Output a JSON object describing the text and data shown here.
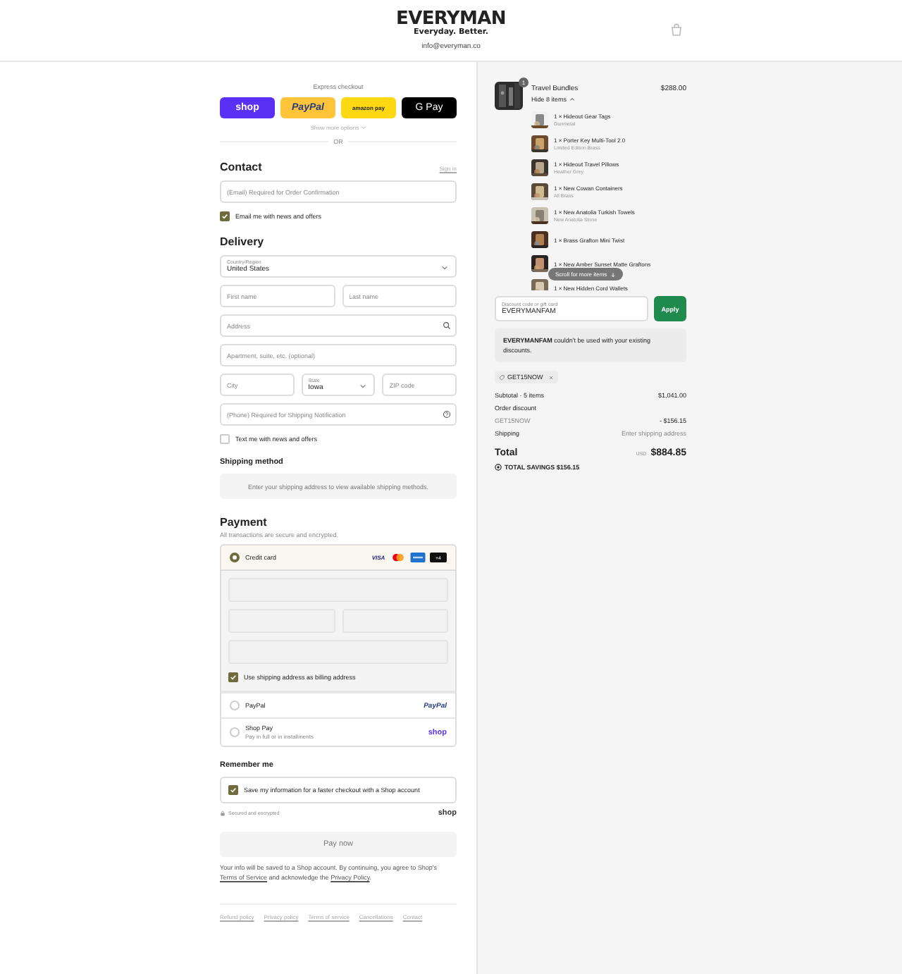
{
  "header": {
    "logo": "EVERYMAN",
    "tagline": "Everyday. Better.",
    "email": "info@everyman.co"
  },
  "express": {
    "label": "Express checkout",
    "buttons": [
      {
        "kind": "shop",
        "label": "shop"
      },
      {
        "kind": "paypal",
        "label": "PayPal"
      },
      {
        "kind": "amazon",
        "label": "amazon pay"
      },
      {
        "kind": "gpay",
        "label": "G Pay"
      }
    ],
    "more": "Show more options",
    "divider": "OR"
  },
  "contact": {
    "title": "Contact",
    "link": "Sign in",
    "email": {
      "placeholder": "(Email) Required for Order Confirmation"
    },
    "news": {
      "label": "Email me with news and offers",
      "checked": true
    }
  },
  "delivery": {
    "title": "Delivery",
    "rows": [
      [
        {
          "kind": "select",
          "label": "Country/Region",
          "value": "United States"
        }
      ],
      [
        {
          "kind": "text",
          "placeholder": "First name"
        },
        {
          "kind": "text",
          "placeholder": "Last name"
        }
      ],
      [
        {
          "kind": "search",
          "placeholder": "Address"
        }
      ],
      [
        {
          "kind": "text",
          "placeholder": "Apartment, suite, etc. (optional)"
        }
      ],
      [
        {
          "kind": "text",
          "placeholder": "City"
        },
        {
          "kind": "select",
          "label": "State",
          "value": "Iowa"
        },
        {
          "kind": "text",
          "placeholder": "ZIP code"
        }
      ],
      [
        {
          "kind": "help",
          "placeholder": "(Phone) Required for Shipping Notification"
        }
      ]
    ],
    "sms": {
      "label": "Text me with news and offers",
      "checked": false
    }
  },
  "shipping": {
    "title": "Shipping method",
    "note": "Enter your shipping address to view available shipping methods."
  },
  "payment": {
    "title": "Payment",
    "subtitle": "All transactions are secure and encrypted.",
    "methods": [
      {
        "kind": "card",
        "label": "Credit card",
        "selected": true,
        "brands": [
          {
            "kind": "visa",
            "text": "VISA"
          },
          {
            "kind": "mastercard"
          },
          {
            "kind": "amex"
          },
          {
            "kind": "more",
            "text": "+4"
          }
        ],
        "billing": {
          "label": "Use shipping address as billing address",
          "checked": true
        }
      },
      {
        "kind": "paypal",
        "label": "PayPal",
        "selected": false,
        "logo": "PayPal"
      },
      {
        "kind": "shoppay",
        "label": "Shop Pay",
        "sublabel": "Pay in full or in installments",
        "selected": false,
        "logo": "shop"
      }
    ]
  },
  "remember": {
    "title": "Remember me",
    "save": {
      "label": "Save my information for a faster checkout with a Shop account",
      "checked": true
    },
    "secure": "Secured and encrypted",
    "brand": "shop"
  },
  "pay_button": "Pay now",
  "legal": [
    {
      "text": "Your info will be saved to a Shop account. By continuing, you agree to Shop's "
    },
    {
      "link": "Terms of Service"
    },
    {
      "text": " and acknowledge the "
    },
    {
      "link": "Privacy Policy"
    },
    {
      "text": "."
    }
  ],
  "footer_links": [
    "Refund policy",
    "Privacy policy",
    "Terms of service",
    "Cancellations",
    "Contact"
  ],
  "bundle": {
    "title": "Travel Bundles",
    "quantity": "1",
    "price": "$288.00",
    "toggle": "Hide 8 items",
    "items": [
      {
        "name": "1 × Hideout Gear Tags",
        "variant": "Gunmetal"
      },
      {
        "name": "1 × Porter Key Multi-Tool 2.0",
        "variant": "Limited Edition Brass"
      },
      {
        "name": "1 × Hideout Travel Pillows",
        "variant": "Heather Grey"
      },
      {
        "name": "1 × New Cowan Containers",
        "variant": "All Brass"
      },
      {
        "name": "1 × New Anatolia Turkish Towels",
        "variant": "New Anatolia Stone"
      },
      {
        "name": "1 × Brass Grafton Mini Twist"
      },
      {
        "name": "1 × New Amber Sunset Matte Graftons"
      },
      {
        "name": "1 × New Hidden Cord Wallets"
      }
    ],
    "scroll_hint": "Scroll for more items"
  },
  "discount": {
    "label": "Discount code or gift card",
    "value": "EVERYMANFAM",
    "button": "Apply",
    "error": "**EVERYMANFAM** couldn't be used with your existing discounts.",
    "tags": [
      "GET15NOW"
    ]
  },
  "summary": {
    "subtotal_label": "Subtotal · 5 items",
    "subtotal": "$1,041.00",
    "discount_label": "Order discount",
    "discount_code": "GET15NOW",
    "discount_amount": "- $156.15",
    "shipping_label": "Shipping",
    "shipping": "Enter shipping address",
    "total_label": "Total",
    "currency": "USD",
    "total": "$884.85",
    "savings": "TOTAL SAVINGS $156.15"
  }
}
